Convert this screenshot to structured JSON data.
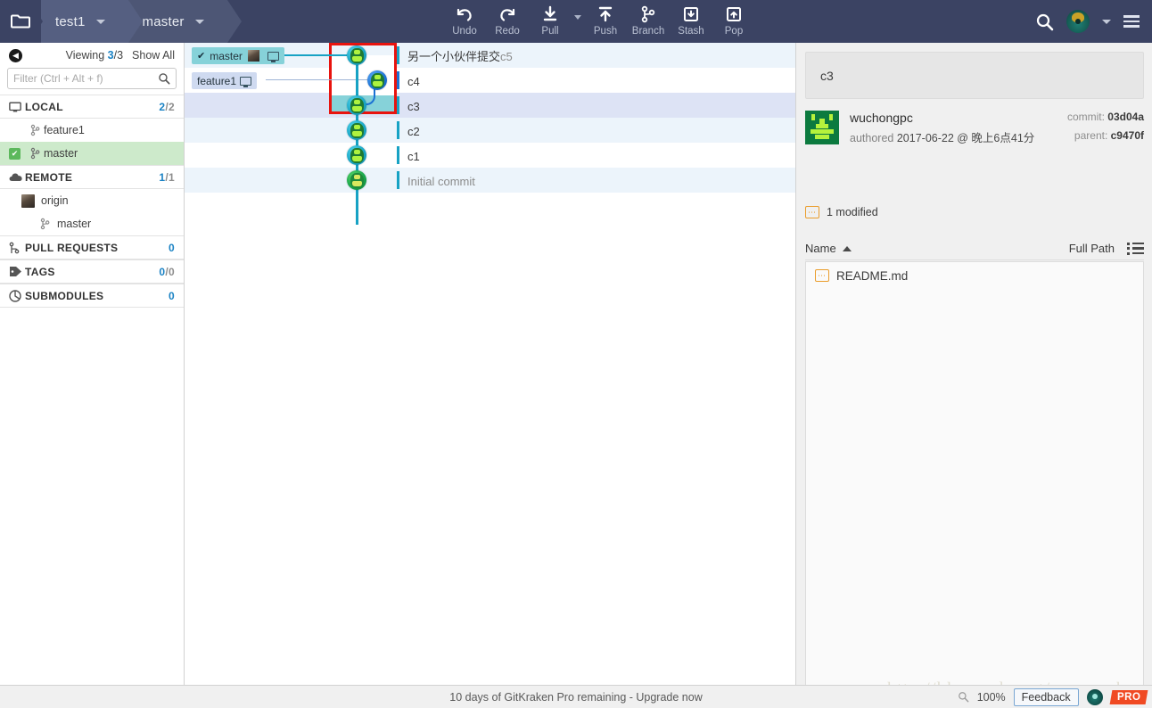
{
  "titlebar": {
    "folder_icon": "folder-icon",
    "repo_name": "test1",
    "branch_name": "master",
    "search_icon": "search-icon",
    "avatar_icon": "user-avatar-icon",
    "menu_icon": "hamburger-menu-icon",
    "tools": [
      {
        "id": "undo",
        "label": "Undo",
        "icon": "undo-arrow-icon"
      },
      {
        "id": "redo",
        "label": "Redo",
        "icon": "redo-arrow-icon"
      },
      {
        "id": "pull",
        "label": "Pull",
        "icon": "download-arrow-icon"
      },
      {
        "id": "push",
        "label": "Push",
        "icon": "upload-arrow-icon"
      },
      {
        "id": "branch",
        "label": "Branch",
        "icon": "branch-fork-icon"
      },
      {
        "id": "stash",
        "label": "Stash",
        "icon": "stash-box-down-icon"
      },
      {
        "id": "pop",
        "label": "Pop",
        "icon": "pop-box-up-icon"
      }
    ]
  },
  "sidebar": {
    "back_icon": "back-arrow-icon",
    "viewing_label": "Viewing",
    "viewing_count": "3",
    "viewing_total": "/3",
    "show_all": "Show All",
    "filter_placeholder": "Filter (Ctrl + Alt + f)",
    "filter_value": "",
    "search_icon": "search-icon",
    "sections": [
      {
        "id": "local",
        "title": "LOCAL",
        "icon": "monitor-icon",
        "count": "2",
        "count_total": "/2",
        "items": [
          {
            "label": "feature1",
            "icon": "branch-icon",
            "checked": false
          },
          {
            "label": "master",
            "icon": "branch-icon",
            "checked": true
          }
        ]
      },
      {
        "id": "remote",
        "title": "REMOTE",
        "icon": "cloud-icon",
        "count": "1",
        "count_total": "/1",
        "items": [
          {
            "label": "origin",
            "icon": "remote-avatar-icon",
            "checked": false
          },
          {
            "label": "master",
            "icon": "branch-icon",
            "checked": false,
            "indent": true
          }
        ]
      },
      {
        "id": "pull-requests",
        "title": "PULL REQUESTS",
        "icon": "pull-request-icon",
        "count": "0",
        "count_total": "",
        "items": []
      },
      {
        "id": "tags",
        "title": "TAGS",
        "icon": "tag-icon",
        "count": "0",
        "count_total": "/0",
        "items": []
      },
      {
        "id": "submodules",
        "title": "SUBMODULES",
        "icon": "submodule-icon",
        "count": "0",
        "count_total": "",
        "items": []
      }
    ]
  },
  "graph": {
    "refs": [
      {
        "id": "master",
        "label": "master",
        "has_check": true,
        "has_avatar": true,
        "has_monitor": true
      },
      {
        "id": "feature1",
        "label": "feature1",
        "has_check": false,
        "has_avatar": false,
        "has_monitor": true
      }
    ],
    "commits": [
      {
        "id": "c5",
        "message": "另一个小伙伴提交",
        "message_suffix": "c5",
        "lane": "teal",
        "selected": false,
        "highlight": true
      },
      {
        "id": "c4",
        "message": "c4",
        "message_suffix": "",
        "lane": "blue",
        "selected": false,
        "highlight": false
      },
      {
        "id": "c3",
        "message": "c3",
        "message_suffix": "",
        "lane": "teal",
        "selected": true,
        "highlight": false
      },
      {
        "id": "c2",
        "message": "c2",
        "message_suffix": "",
        "lane": "teal",
        "selected": false,
        "highlight": true
      },
      {
        "id": "c1",
        "message": "c1",
        "message_suffix": "",
        "lane": "teal",
        "selected": false,
        "highlight": false
      },
      {
        "id": "initial",
        "message": "Initial commit",
        "message_suffix": "",
        "lane": "green",
        "selected": false,
        "highlight": true
      }
    ]
  },
  "details": {
    "commit_message": "c3",
    "author_name": "wuchongpc",
    "authored_prefix": "authored",
    "authored_date": "2017-06-22 @ 晚上6点41分",
    "commit_label": "commit:",
    "commit_sha": "03d04a",
    "parent_label": "parent:",
    "parent_sha": "c9470f",
    "changes_summary": "1 modified",
    "changes_icon": "modified-file-icon",
    "col_name": "Name",
    "col_full_path": "Full Path",
    "list_view_icon": "list-view-icon",
    "sort_icon": "sort-ascending-icon",
    "files": [
      {
        "name": "README.md",
        "icon": "modified-file-icon"
      }
    ]
  },
  "footer": {
    "status_text": "10 days of GitKraken Pro remaining - Upgrade now",
    "zoom_icon": "zoom-icon",
    "zoom_level": "100%",
    "feedback_label": "Feedback",
    "kraken_icon": "gitkraken-logo-icon",
    "pro_badge": "PRO",
    "watermark": "http://blog.csdn.net/mn_wush"
  }
}
